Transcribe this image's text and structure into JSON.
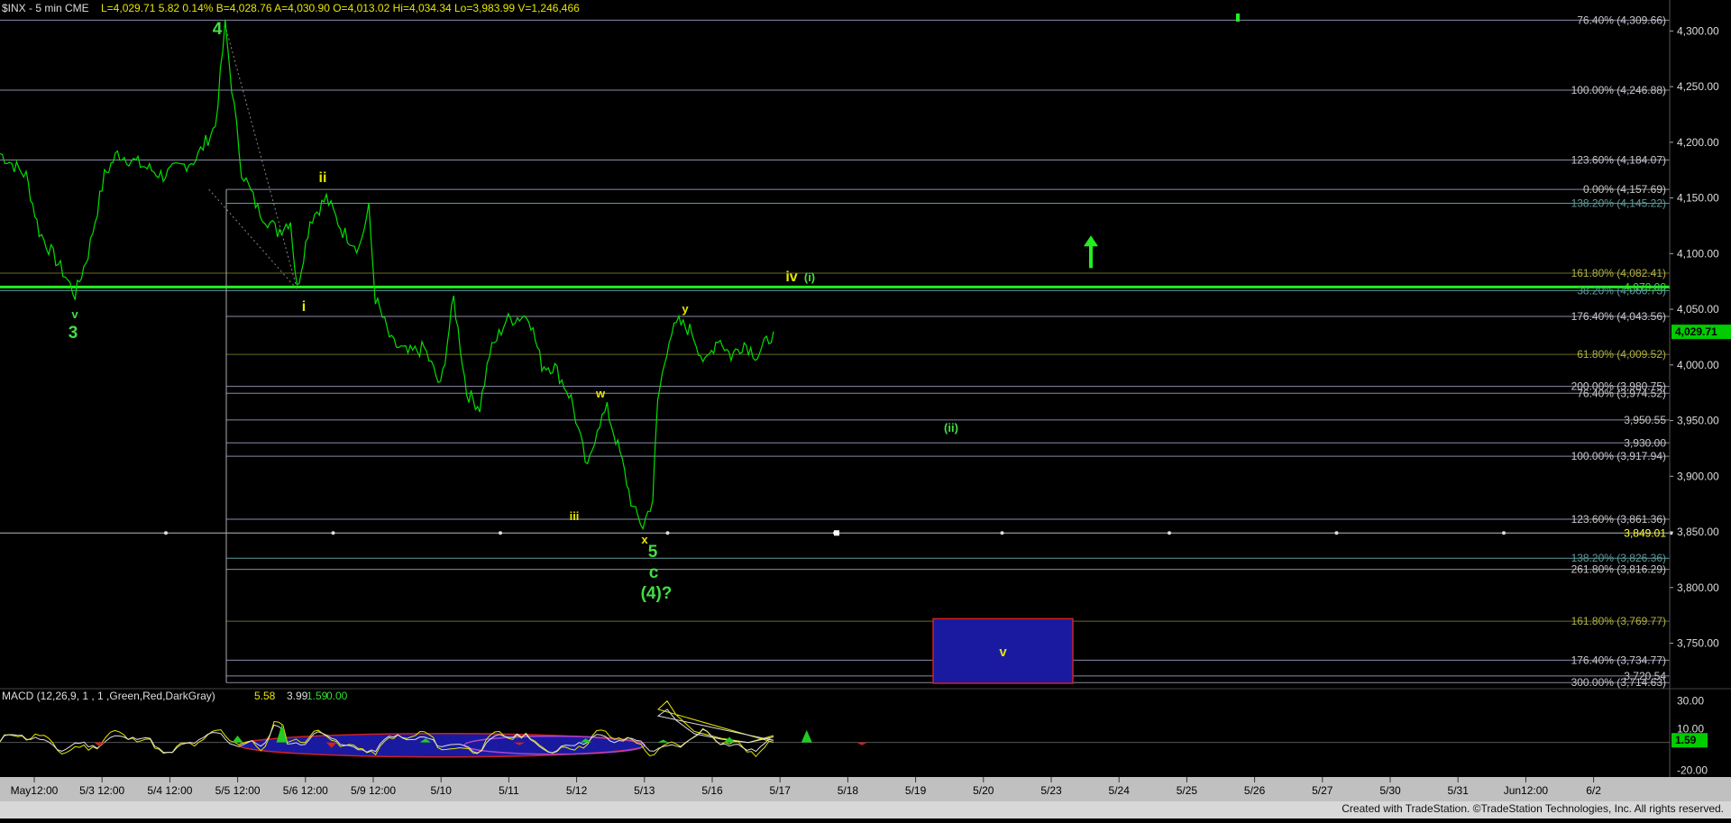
{
  "window": {
    "title": "$INX - 5 min  CME",
    "quote": "L=4,029.71  5.82  0.14%  B=4,028.76  A=4,030.90  O=4,013.02  Hi=4,034.34  Lo=3,983.99  V=1,246,466",
    "footer": "Created with TradeStation. ©TradeStation Technologies, Inc. All rights reserved.",
    "last_price_label": "4,029.71"
  },
  "colors": {
    "background": "#000000",
    "price_line": "#00e000",
    "bright_green": "#22ee22",
    "wave_green": "#44dd44",
    "wave_yellow": "#e6e600",
    "fib_line": "#8a8aa8",
    "fib_olive": "#6b6b28",
    "fib_label": "#c8c8c8",
    "target_box": "#1a1aa0",
    "target_border": "#cc2222",
    "footer_bar": "#c0c0c0"
  },
  "chart_data": [
    {
      "type": "line",
      "title": "$INX - 5 min  CME",
      "xlabel": "",
      "ylabel": "",
      "ylim": [
        3714,
        4310
      ],
      "x_ticks": [
        "May12:00",
        "5/3 12:00",
        "5/4 12:00",
        "5/5 12:00",
        "5/6 12:00",
        "5/9 12:00",
        "5/10",
        "5/11",
        "5/12",
        "5/13",
        "5/16",
        "5/17",
        "5/18",
        "5/19",
        "5/20",
        "5/23",
        "5/24",
        "5/25",
        "5/26",
        "5/27",
        "5/30",
        "5/31",
        "Jun12:00",
        "6/2"
      ],
      "y_ticks": [
        "4,300.00",
        "4,250.00",
        "4,200.00",
        "4,150.00",
        "4,100.00",
        "4,050.00",
        "4,000.00",
        "3,950.00",
        "3,900.00",
        "3,850.00",
        "3,800.00",
        "3,750.00"
      ],
      "grid": false,
      "price_keypoints": [
        [
          0,
          4190
        ],
        [
          0.8,
          4170
        ],
        [
          1.2,
          4120
        ],
        [
          2.0,
          4080
        ],
        [
          2.3,
          4063
        ],
        [
          2.7,
          4100
        ],
        [
          3.2,
          4170
        ],
        [
          3.6,
          4190
        ],
        [
          4.3,
          4180
        ],
        [
          5.0,
          4170
        ],
        [
          6.0,
          4185
        ],
        [
          6.6,
          4215
        ],
        [
          6.9,
          4305
        ],
        [
          7.1,
          4250
        ],
        [
          7.4,
          4175
        ],
        [
          7.9,
          4140
        ],
        [
          8.5,
          4120
        ],
        [
          8.9,
          4130
        ],
        [
          9.1,
          4068
        ],
        [
          9.5,
          4130
        ],
        [
          10.0,
          4150
        ],
        [
          10.5,
          4120
        ],
        [
          11.0,
          4105
        ],
        [
          11.3,
          4140
        ],
        [
          11.5,
          4060
        ],
        [
          12.0,
          4020
        ],
        [
          12.5,
          4010
        ],
        [
          13.0,
          4015
        ],
        [
          13.5,
          3980
        ],
        [
          13.9,
          4060
        ],
        [
          14.3,
          3975
        ],
        [
          14.7,
          3962
        ],
        [
          15.0,
          4010
        ],
        [
          15.5,
          4040
        ],
        [
          16.2,
          4045
        ],
        [
          16.6,
          4000
        ],
        [
          17.0,
          3998
        ],
        [
          17.5,
          3970
        ],
        [
          18.0,
          3905
        ],
        [
          18.3,
          3945
        ],
        [
          18.6,
          3960
        ],
        [
          19.0,
          3920
        ],
        [
          19.4,
          3870
        ],
        [
          19.7,
          3855
        ],
        [
          20.0,
          3880
        ],
        [
          20.15,
          3968
        ],
        [
          20.5,
          4025
        ],
        [
          20.8,
          4038
        ],
        [
          21.2,
          4030
        ],
        [
          21.6,
          4000
        ],
        [
          22.0,
          4025
        ],
        [
          22.4,
          4008
        ],
        [
          22.8,
          4020
        ],
        [
          23.2,
          4008
        ],
        [
          23.7,
          4030
        ]
      ],
      "series": [
        {
          "name": "MACD",
          "values": [
            5.58
          ]
        },
        {
          "name": "",
          "values": [
            3.99
          ]
        },
        {
          "name": "",
          "values": [
            1.59
          ]
        },
        {
          "name": "",
          "values": [
            0.0
          ]
        }
      ],
      "last_value": 4029.71,
      "horizontal_lines": [
        {
          "label": "76.40% (4,309.66)",
          "value": 4309.66,
          "color": "fib"
        },
        {
          "label": "100.00% (4,246.88)",
          "value": 4246.88,
          "color": "fib"
        },
        {
          "label": "123.60% (4,184.07)",
          "value": 4184.07,
          "color": "fib"
        },
        {
          "label": "0.00% (4,157.69)",
          "value": 4157.69,
          "color": "fib"
        },
        {
          "label": "138.20% (4,145.22)",
          "value": 4145.22,
          "color": "teal"
        },
        {
          "label": "161.80% (4,082.41)",
          "value": 4082.41,
          "color": "olive"
        },
        {
          "label": "4,070.00",
          "value": 4070.0,
          "color": "green"
        },
        {
          "label": "38.20% (4,066.73)",
          "value": 4066.73,
          "color": "teal"
        },
        {
          "label": "176.40% (4,043.56)",
          "value": 4043.56,
          "color": "fib"
        },
        {
          "label": "61.80% (4,009.52)",
          "value": 4009.52,
          "color": "olive"
        },
        {
          "label": "200.00% (3,980.75)",
          "value": 3980.75,
          "color": "fib"
        },
        {
          "label": "76.40% (3,974.52)",
          "value": 3974.52,
          "color": "fib"
        },
        {
          "label": "3,950.55",
          "value": 3950.55,
          "color": "fib"
        },
        {
          "label": "3,930.00",
          "value": 3930.0,
          "color": "fib"
        },
        {
          "label": "100.00% (3,917.94)",
          "value": 3917.94,
          "color": "fib"
        },
        {
          "label": "123.60% (3,861.36)",
          "value": 3861.36,
          "color": "fib"
        },
        {
          "label": "3,849.01",
          "value": 3849.01,
          "color": "yellow"
        },
        {
          "label": "138.20% (3,826.36)",
          "value": 3826.36,
          "color": "teal"
        },
        {
          "label": "261.80% (3,816.29)",
          "value": 3816.29,
          "color": "fib"
        },
        {
          "label": "161.80% (3,769.77)",
          "value": 3769.77,
          "color": "olive"
        },
        {
          "label": "176.40% (3,734.77)",
          "value": 3734.77,
          "color": "fib"
        },
        {
          "label": "3,720.54",
          "value": 3720.54,
          "color": "fib"
        },
        {
          "label": "300.00% (3,714.63)",
          "value": 3714.63,
          "color": "fib"
        }
      ],
      "target_box": {
        "x_from": 16.2,
        "x_to": 18.6,
        "y_from": 3772,
        "y_to": 3714,
        "label": "v"
      },
      "annotations": [
        {
          "text": "4",
          "x": 6.8,
          "y": 4300,
          "color": "green",
          "size": "large"
        },
        {
          "text": "v",
          "x": 2.3,
          "y": 4057,
          "color": "green",
          "size": "small"
        },
        {
          "text": "3",
          "x": 2.3,
          "y": 4035,
          "color": "green",
          "size": "large"
        },
        {
          "text": "ii",
          "x": 9.6,
          "y": 4165,
          "color": "yellow",
          "size": "medium"
        },
        {
          "text": "i",
          "x": 9.0,
          "y": 4050,
          "color": "yellow",
          "size": "medium"
        },
        {
          "text": "iv",
          "x": 22.7,
          "y": 4078,
          "color": "yellow",
          "size": "medium"
        },
        {
          "text": "(i)",
          "x": 23.3,
          "y": 4078,
          "color": "green",
          "size": "small"
        },
        {
          "text": "y",
          "x": 20.5,
          "y": 4050,
          "color": "yellow",
          "size": "small"
        },
        {
          "text": "w",
          "x": 18.0,
          "y": 3972,
          "color": "yellow",
          "size": "small"
        },
        {
          "text": "iii",
          "x": 17.0,
          "y": 3866,
          "color": "yellow",
          "size": "small"
        },
        {
          "text": "x",
          "x": 19.1,
          "y": 3843,
          "color": "yellow",
          "size": "small"
        },
        {
          "text": "5",
          "x": 19.4,
          "y": 3832,
          "color": "green",
          "size": "large"
        },
        {
          "text": "c",
          "x": 19.4,
          "y": 3812,
          "color": "green",
          "size": "large"
        },
        {
          "text": "(4)?",
          "x": 19.6,
          "y": 3790,
          "color": "green",
          "size": "large"
        },
        {
          "text": "(ii)",
          "x": 27.5,
          "y": 3944,
          "color": "green",
          "size": "small"
        }
      ],
      "up_arrow": {
        "x": 30.0,
        "y_from": 4087,
        "y_to": 4113
      }
    }
  ],
  "macd": {
    "label": "MACD (12,26,9, 1 , 1 ,Green,Red,DarkGray)",
    "values": [
      "5.58",
      "3.99",
      "1.59",
      "0.00"
    ],
    "y_ticks": [
      "30.00",
      "10.00",
      "0.00",
      "-20.00"
    ],
    "last_label": "1.59",
    "ylim": [
      -25,
      35
    ]
  }
}
